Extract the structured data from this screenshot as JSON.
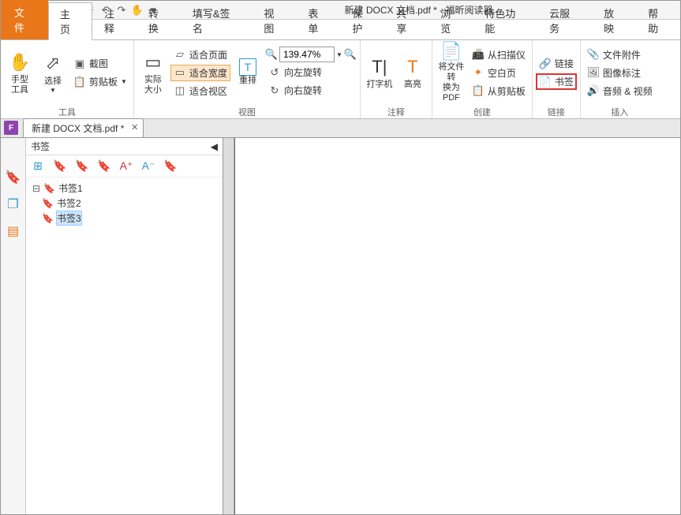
{
  "window": {
    "title": "新建 DOCX 文档.pdf * - 福昕阅读器"
  },
  "tabs": {
    "file": "文件",
    "home": "主页",
    "comment": "注释",
    "convert": "转换",
    "fillsign": "填写&签名",
    "view": "视图",
    "form": "表单",
    "protect": "保护",
    "share": "共享",
    "browse": "浏览",
    "feature": "特色功能",
    "cloud": "云服务",
    "play": "放映",
    "help": "帮助"
  },
  "ribbon": {
    "tools": {
      "label": "工具",
      "hand": "手型\n工具",
      "select": "选择",
      "screenshot": "截图",
      "clipboard": "剪贴板"
    },
    "view": {
      "label": "视图",
      "actual": "实际\n大小",
      "fitpage": "适合页面",
      "fitwidth": "适合宽度",
      "fitvisible": "适合视区",
      "reflow": "重排",
      "rotateleft": "向左旋转",
      "rotateright": "向右旋转",
      "zoom": "139.47%"
    },
    "comment": {
      "label": "注释",
      "typewriter": "打字机",
      "highlight": "高亮"
    },
    "create": {
      "label": "创建",
      "frompdf": "将文件转\n换为PDF",
      "scanner": "从扫描仪",
      "blank": "空白页",
      "clipboard": "从剪贴板"
    },
    "link": {
      "label": "链接",
      "link": "链接",
      "bookmark": "书签"
    },
    "insert": {
      "label": "插入",
      "attach": "文件附件",
      "imagemark": "图像标注",
      "media": "音频 & 视频"
    }
  },
  "doc": {
    "tab": "新建 DOCX 文档.pdf *"
  },
  "panel": {
    "title": "书签",
    "items": [
      "书签1",
      "书签2",
      "书签3"
    ]
  }
}
